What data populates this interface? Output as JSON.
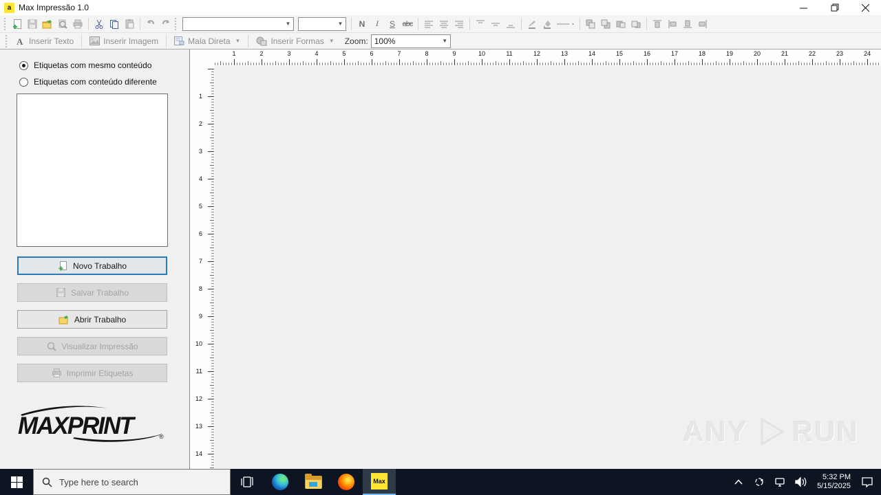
{
  "window": {
    "title": "Max Impressão 1.0",
    "icon_letter": "a"
  },
  "toolbar_format": {
    "bold": "N",
    "italic": "I",
    "underline": "S",
    "strikethrough": "abc"
  },
  "toolbar_insert": {
    "insert_text": "Inserir Texto",
    "insert_image": "Inserir Imagem",
    "mail_merge": "Mala Direta",
    "insert_shapes": "Inserir Formas",
    "zoom_label": "Zoom:",
    "zoom_value": "100%"
  },
  "sidebar": {
    "radio_same_content": "Etiquetas com mesmo conteúdo",
    "radio_different_content": "Etiquetas com conteúdo diferente",
    "buttons": [
      {
        "label": "Novo Trabalho",
        "state": "focused"
      },
      {
        "label": "Salvar Trabalho",
        "state": "disabled"
      },
      {
        "label": "Abrir Trabalho",
        "state": "enabled"
      },
      {
        "label": "Visualizar Impressão",
        "state": "disabled"
      },
      {
        "label": "Imprimir Etiquetas",
        "state": "disabled"
      }
    ],
    "logo_text": "MAXPRINT",
    "logo_registered": "®"
  },
  "rulers": {
    "unit": "cm",
    "horizontal_numbers": [
      1,
      2,
      3,
      4,
      5,
      6,
      7,
      8,
      9,
      10,
      11,
      12,
      13,
      14,
      15,
      16,
      17,
      18,
      19,
      20,
      21,
      22,
      23,
      24
    ],
    "vertical_numbers": [
      1,
      2,
      3,
      4,
      5,
      6,
      7,
      8,
      9,
      10,
      11,
      12,
      13,
      14
    ]
  },
  "watermark": {
    "left": "ANY",
    "right": "RUN"
  },
  "taskbar": {
    "search_placeholder": "Type here to search",
    "app_label": "Max",
    "time": "5:32 PM",
    "date": "5/15/2025"
  },
  "icons": {
    "toolbar1": [
      "new-document-icon",
      "save-icon",
      "open-folder-icon",
      "print-preview-icon",
      "print-icon",
      "cut-icon",
      "copy-icon",
      "paste-icon",
      "undo-icon",
      "redo-icon",
      "align-left-icon",
      "align-center-icon",
      "align-right-icon",
      "valign-top-icon",
      "valign-middle-icon",
      "valign-bottom-icon",
      "font-color-icon",
      "fill-color-icon",
      "line-style-icon",
      "bring-front-icon",
      "send-back-icon",
      "bring-forward-icon",
      "send-backward-icon",
      "align-top-edge-icon",
      "align-left-edge-icon",
      "align-bottom-edge-icon",
      "align-right-edge-icon"
    ],
    "colors": {
      "taskbar_bg": "#0d1522",
      "accent_blue": "#2a7ab9",
      "max_yellow": "#ffe733",
      "active_underline": "#76b9ed"
    }
  }
}
